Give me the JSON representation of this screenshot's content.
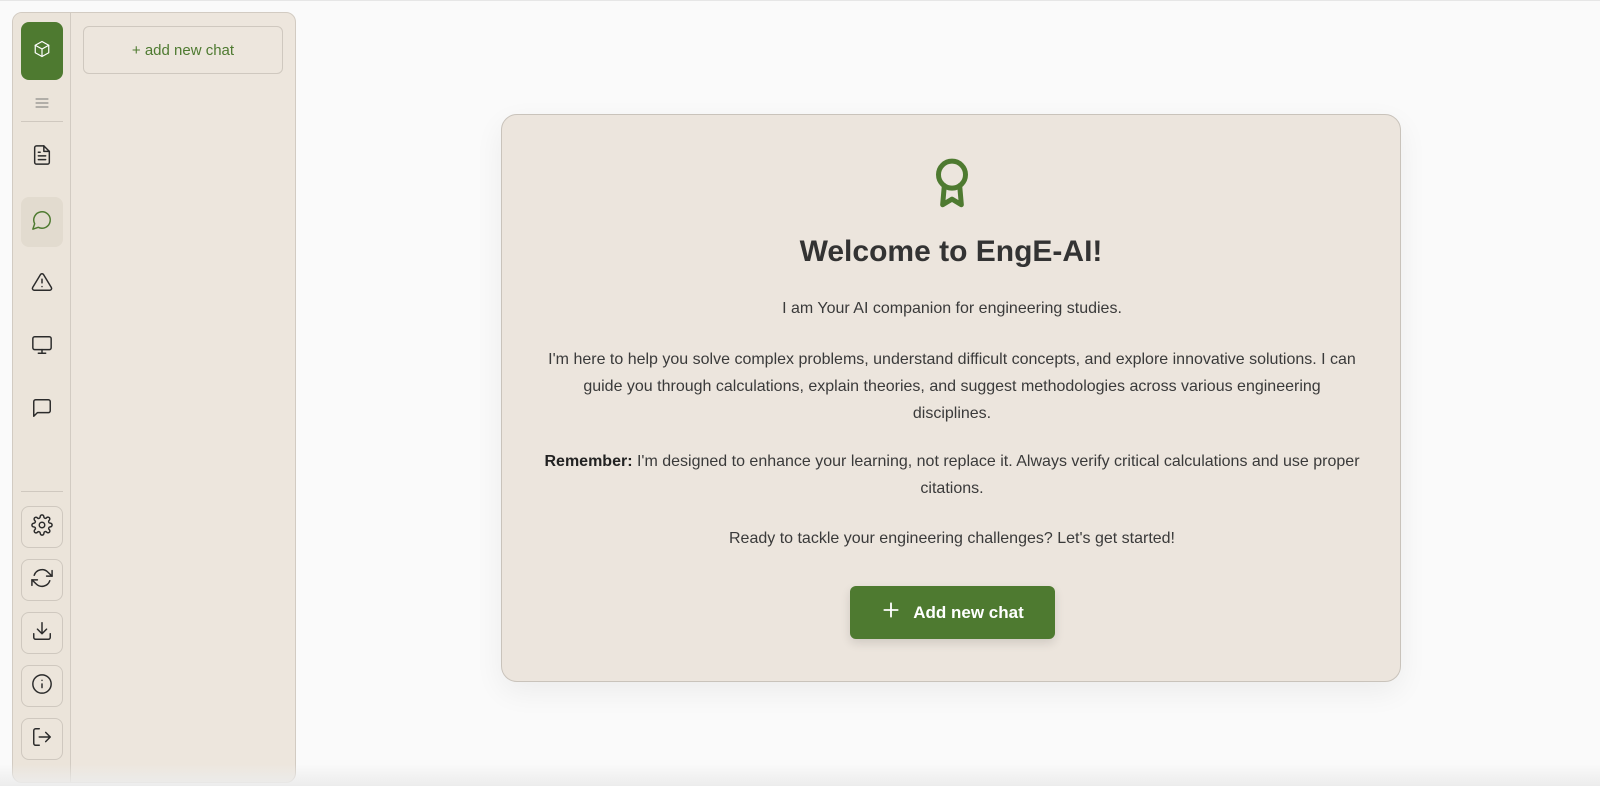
{
  "sidebar": {
    "add_new_chat_label": "+ add new chat",
    "rail_icons": [
      "app-logo-icon",
      "menu-icon",
      "document-icon",
      "chat-icon",
      "warning-icon",
      "monitor-icon",
      "message-square-icon",
      "settings-icon",
      "refresh-icon",
      "download-icon",
      "info-icon",
      "logout-icon"
    ],
    "active_item": "chat-icon"
  },
  "welcome": {
    "title": "Welcome to EngE-AI!",
    "intro": "I am Your AI companion for engineering studies.",
    "description": "I'm here to help you solve complex problems, understand difficult concepts, and explore innovative solutions. I can guide you through calculations, explain theories, and suggest methodologies across various engineering disciplines.",
    "remember_label": "Remember:",
    "remember_text": " I'm designed to enhance your learning, not replace it. Always verify critical calculations and use proper citations.",
    "closing": "Ready to tackle your engineering challenges? Let's get started!",
    "cta_label": "Add new chat"
  },
  "colors": {
    "accent": "#4e7a30",
    "panel_bg": "#ede6dd",
    "page_bg": "#fafafa"
  }
}
